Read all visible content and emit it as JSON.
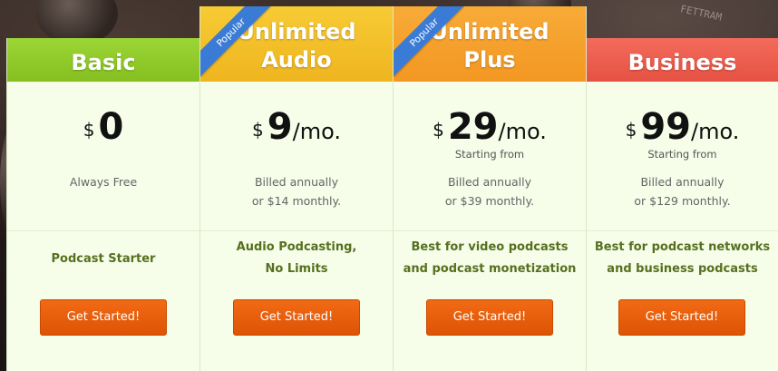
{
  "plans": [
    {
      "name_line1": "Basic",
      "name_line2": "",
      "popular": "",
      "currency": "$",
      "amount": "0",
      "period": "",
      "starting_from": "",
      "billed_line1": "Always Free",
      "billed_line2": "",
      "feature_line1": "Podcast Starter",
      "feature_line2": "",
      "cta": "Get Started!",
      "header_color": "#8fcc2c"
    },
    {
      "name_line1": "Unlimited",
      "name_line2": "Audio",
      "popular": "Popular",
      "currency": "$",
      "amount": "9",
      "period": "/mo.",
      "starting_from": "",
      "billed_line1": "Billed annually",
      "billed_line2": "or $14 monthly.",
      "feature_line1": "Audio Podcasting,",
      "feature_line2": "No Limits",
      "cta": "Get Started!",
      "header_color": "#f2c12b"
    },
    {
      "name_line1": "Unlimited",
      "name_line2": "Plus",
      "popular": "Popular",
      "currency": "$",
      "amount": "29",
      "period": "/mo.",
      "starting_from": "Starting from",
      "billed_line1": "Billed annually",
      "billed_line2": "or $39 monthly.",
      "feature_line1": "Best for video podcasts",
      "feature_line2": "and podcast monetization",
      "cta": "Get Started!",
      "header_color": "#f6a12e"
    },
    {
      "name_line1": "Business",
      "name_line2": "",
      "popular": "",
      "currency": "$",
      "amount": "99",
      "period": "/mo.",
      "starting_from": "Starting from",
      "billed_line1": "Billed annually",
      "billed_line2": "or $129 monthly.",
      "feature_line1": "Best for podcast networks",
      "feature_line2": "and business podcasts",
      "cta": "Get Started!",
      "header_color": "#ef5d4f"
    }
  ],
  "background": {
    "equipment_label": "FETTRAM"
  }
}
